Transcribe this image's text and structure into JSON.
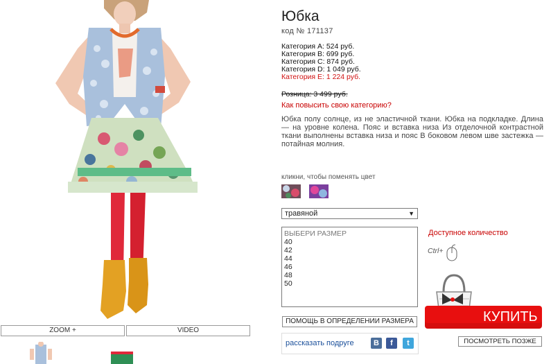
{
  "product": {
    "title": "Юбка",
    "code": "код № 171137",
    "prices": [
      {
        "label": "Категория А: 524 руб."
      },
      {
        "label": "Категория B: 699 руб."
      },
      {
        "label": "Категория С: 874 руб."
      },
      {
        "label": "Категория D: 1 049 руб."
      },
      {
        "label": "Категория E: 1 224 руб."
      }
    ],
    "retail": "Розница: 3 499 руб.",
    "upgrade_link": "Как повысить свою категорию?",
    "description": "Юбка полу солнце, из не эластичной ткани. Юбка на подкладке. Длина — на уровне колена. Пояс и вставка низа Из отделочной контрастной ткани выполнены вставка низа и пояс В боковом левом шве застежка — потайная молния."
  },
  "gallery": {
    "zoom_label": "ZOOM +",
    "video_label": "VIDEO"
  },
  "colors": {
    "hint": "кликни, чтобы поменять цвет",
    "selected": "травяной"
  },
  "sizes": {
    "placeholder": "ВЫБЕРИ РАЗМЕР",
    "options": [
      "40",
      "42",
      "44",
      "46",
      "48",
      "50"
    ]
  },
  "availability": "Доступное количество",
  "ctrl_hint": "Ctrl+",
  "help_button": "ПОМОЩЬ В ОПРЕДЕЛЕНИИ РАЗМЕРА",
  "share": {
    "label": "рассказать подруге",
    "vk": "В",
    "fb": "f",
    "tw": "t"
  },
  "buy_button": "КУПИТЬ",
  "look_button": "ПОСМОТРЕТЬ ПОЗЖЕ",
  "theme": {
    "accent_red": "#e80f0f",
    "link_red": "#c80000",
    "share_blue": "#1a4f9a"
  }
}
